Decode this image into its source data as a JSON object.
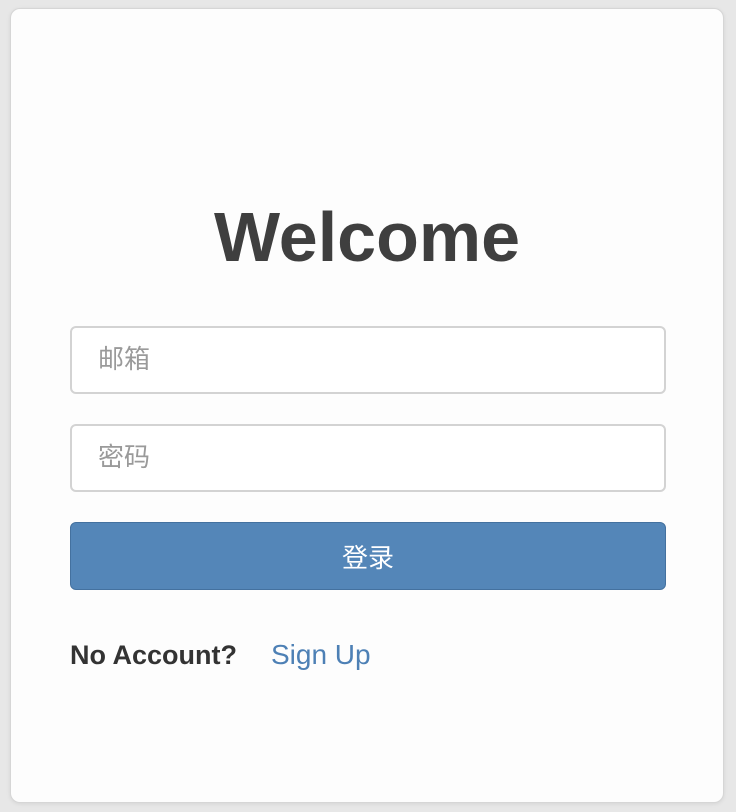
{
  "login": {
    "title": "Welcome",
    "email_placeholder": "邮箱",
    "email_value": "",
    "password_placeholder": "密码",
    "password_value": "",
    "login_label": "登录",
    "no_account_text": "No Account?",
    "signup_link_label": "Sign Up"
  },
  "colors": {
    "background": "#e7e7e7",
    "card": "#fdfdfd",
    "primary_button": "#5486b8",
    "link": "#4d80b5",
    "title_text": "#3f3f3f"
  }
}
